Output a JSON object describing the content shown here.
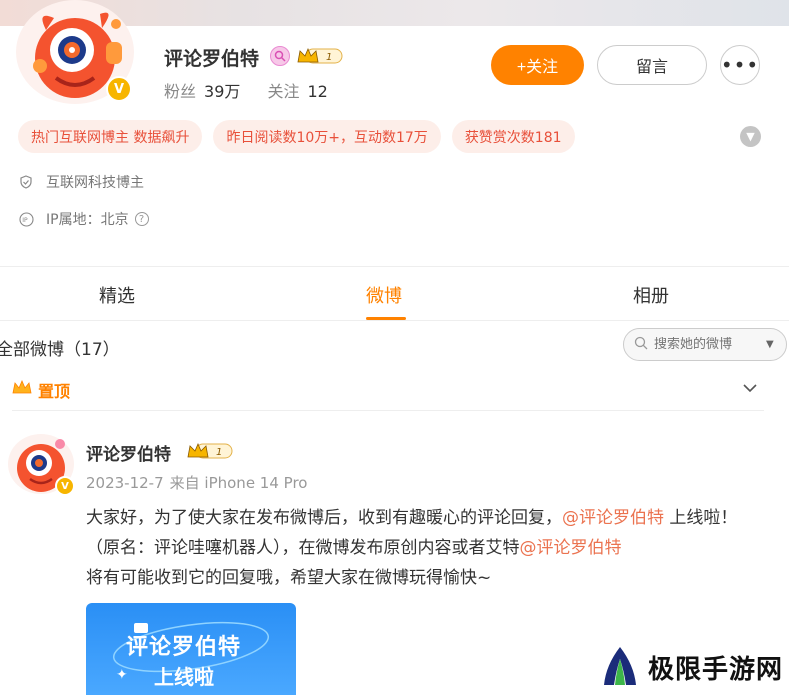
{
  "profile": {
    "name": "评论罗伯特",
    "level_badge": "1",
    "verified_badge": "V",
    "stats": {
      "fans_label": "粉丝",
      "fans_value": "39万",
      "follow_label": "关注",
      "follow_value": "12"
    },
    "follow_button": "+关注",
    "message_button": "留言",
    "more_button": "•••",
    "tags": [
      "热门互联网博主 数据飙升",
      "昨日阅读数10万+，互动数17万",
      "获赞赏次数181"
    ],
    "category": "互联网科技博主",
    "ip_location": "IP属地：北京",
    "help_icon": "?"
  },
  "tabs": [
    {
      "label": "精选",
      "active": false
    },
    {
      "label": "微博",
      "active": true
    },
    {
      "label": "相册",
      "active": false
    }
  ],
  "feed": {
    "all_label": "全部微博（17）",
    "search_placeholder": "搜索她的微博",
    "pinned_label": "置顶",
    "post": {
      "author": "评论罗伯特",
      "level_badge": "1",
      "date": "2023-12-7",
      "source": "来自 iPhone 14 Pro",
      "text_part1": "大家好，为了使大家在发布微博后，收到有趣暖心的评论回复，",
      "mention1": "@评论罗伯特",
      "text_part2": " 上线啦！（原名：评论哇噻机器人），在微博发布原创内容或者艾特",
      "mention2": "@评论罗伯特",
      "text_part3": "将有可能收到它的回复哦，希望大家在微博玩得愉快~",
      "image_line1": "评论罗伯特",
      "image_line2": "上线啦"
    }
  },
  "watermark": {
    "text": "极限手游网"
  },
  "colors": {
    "accent": "#ff8200",
    "tag_bg": "#fdeee9",
    "tag_text": "#e8503a",
    "mention": "#eb7350"
  }
}
